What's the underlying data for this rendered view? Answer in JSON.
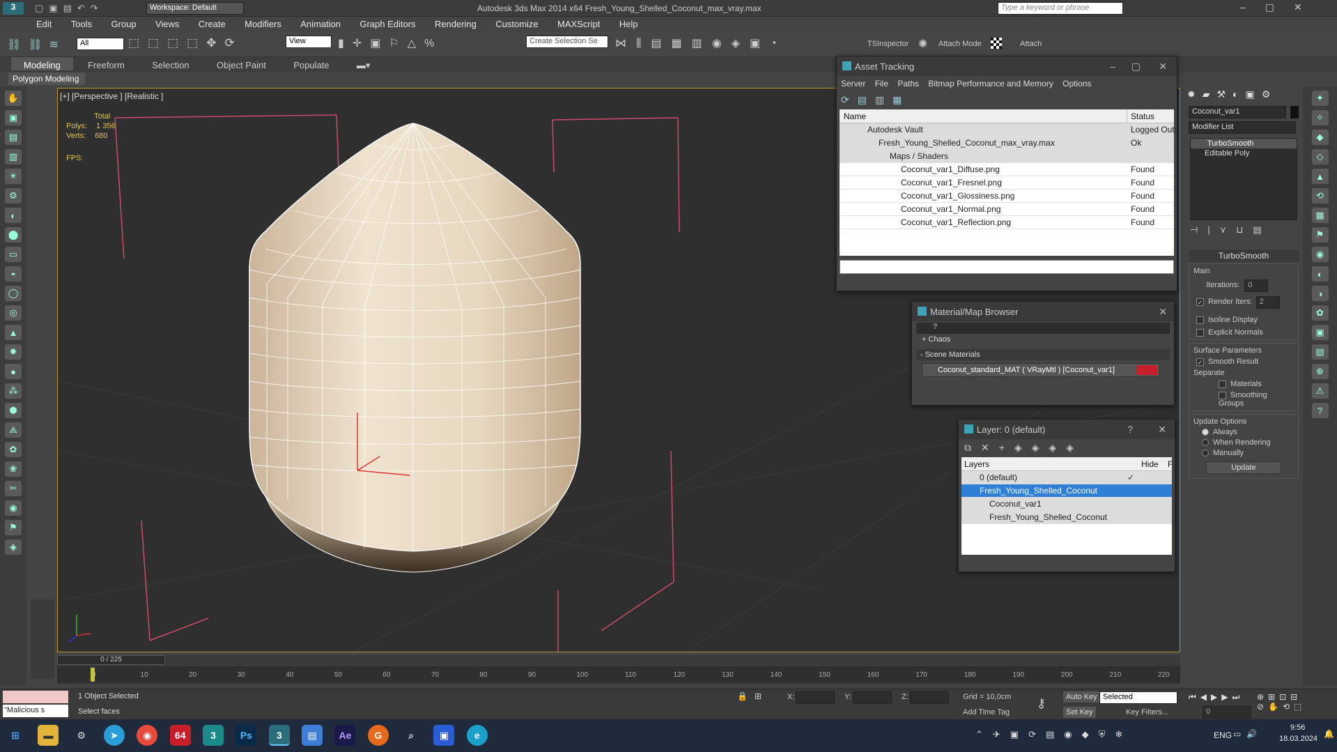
{
  "app": {
    "title": "Autodesk 3ds Max  2014 x64    Fresh_Young_Shelled_Coconut_max_vray.max",
    "workspace": "Workspace: Default",
    "search_placeholder": "Type a keyword or phrase"
  },
  "menu": [
    "Edit",
    "Tools",
    "Group",
    "Views",
    "Create",
    "Modifiers",
    "Animation",
    "Graph Editors",
    "Rendering",
    "Customize",
    "MAXScript",
    "Help"
  ],
  "toolbar": {
    "filter": "All",
    "view": "View",
    "selection_set": "Create Selection Se",
    "tsinspector": "TSInspector",
    "attach_mode": "Attach Mode",
    "attach": "Attach"
  },
  "ribbon": {
    "tabs": [
      "Modeling",
      "Freeform",
      "Selection",
      "Object Paint",
      "Populate"
    ],
    "active": "Modeling",
    "sub": "Polygon Modeling"
  },
  "viewport": {
    "label": "[+] [Perspective ] [Realistic ]",
    "stats_total": "Total",
    "polys_label": "Polys:",
    "polys": "1 356",
    "verts_label": "Verts:",
    "verts": "680",
    "fps_label": "FPS:",
    "axis_x": "x",
    "axis_y": "y",
    "axis_z": "z"
  },
  "asset_tracking": {
    "title": "Asset Tracking",
    "menu": [
      "Server",
      "File",
      "Paths",
      "Bitmap Performance and Memory",
      "Options"
    ],
    "col_name": "Name",
    "col_status": "Status",
    "rows": [
      {
        "name": "Autodesk Vault",
        "status": "Logged Out ."
      },
      {
        "name": "Fresh_Young_Shelled_Coconut_max_vray.max",
        "status": "Ok"
      },
      {
        "name": "Maps / Shaders",
        "status": ""
      },
      {
        "name": "Coconut_var1_Diffuse.png",
        "status": "Found"
      },
      {
        "name": "Coconut_var1_Fresnel.png",
        "status": "Found"
      },
      {
        "name": "Coconut_var1_Glossiness.png",
        "status": "Found"
      },
      {
        "name": "Coconut_var1_Normal.png",
        "status": "Found"
      },
      {
        "name": "Coconut_var1_Reflection.png",
        "status": "Found"
      }
    ]
  },
  "material_browser": {
    "title": "Material/Map Browser",
    "search": "?",
    "group1": "+ Chaos",
    "group2": "- Scene Materials",
    "material": "Coconut_standard_MAT  ( VRayMtl ) [Coconut_var1]"
  },
  "layer": {
    "title": "Layer: 0 (default)",
    "help": "?",
    "col_layers": "Layers",
    "col_hide": "Hide",
    "col_f": "F",
    "rows": [
      "0 (default)",
      "Fresh_Young_Shelled_Coconut",
      "Coconut_var1",
      "Fresh_Young_Shelled_Coconut"
    ]
  },
  "modify_panel": {
    "object_name": "Coconut_var1",
    "modifier_list": "Modifier List",
    "stack": [
      "TurboSmooth",
      "Editable Poly"
    ],
    "rollout": "TurboSmooth",
    "main": "Main",
    "iterations_label": "Iterations:",
    "iterations": "0",
    "render_iters_label": "Render Iters:",
    "render_iters": "2",
    "isoline": "Isoline Display",
    "explicit": "Explicit Normals",
    "surface": "Surface Parameters",
    "smooth_result": "Smooth Result",
    "separate": "Separate",
    "materials": "Materials",
    "smoothing_groups": "Smoothing Groups",
    "update_options": "Update Options",
    "always": "Always",
    "when_rendering": "When Rendering",
    "manually": "Manually",
    "update": "Update"
  },
  "timeline": {
    "frame": "0 / 225",
    "ticks": [
      "0",
      "10",
      "20",
      "30",
      "40",
      "50",
      "60",
      "70",
      "80",
      "90",
      "100",
      "110",
      "120",
      "130",
      "140",
      "150",
      "160",
      "170",
      "180",
      "190",
      "200",
      "210",
      "220"
    ]
  },
  "status": {
    "selected": "1 Object Selected",
    "prompt": "Select faces",
    "script": "\"Malicious s",
    "x_label": "X:",
    "y_label": "Y:",
    "z_label": "Z:",
    "grid": "Grid = 10,0cm",
    "add_time_tag": "Add Time Tag",
    "auto_key": "Auto Key",
    "set_key": "Set Key",
    "selected_dd": "Selected",
    "key_filters": "Key Filters...",
    "frame_num": "0"
  },
  "taskbar": {
    "badge": "64",
    "lang": "ENG",
    "time": "9:56",
    "date": "18.03.2024"
  }
}
